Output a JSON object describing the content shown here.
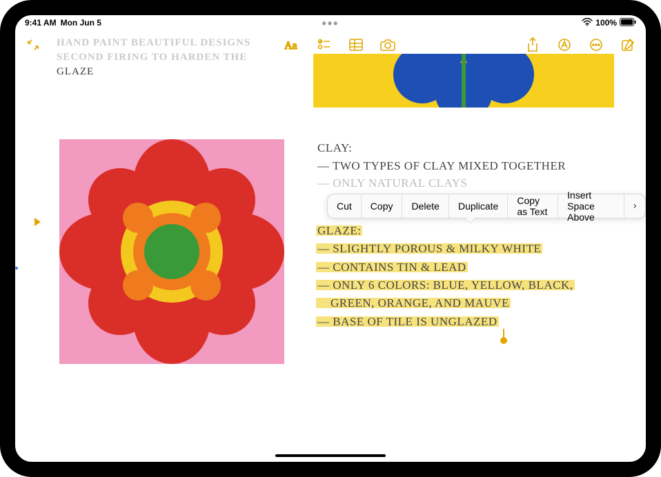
{
  "status": {
    "time": "9:41 AM",
    "date": "Mon Jun 5",
    "battery_pct": "100%"
  },
  "left_note": {
    "line1": "HAND PAINT BEAUTIFUL DESIGNS",
    "line2": "SECOND FIRING TO HARDEN THE",
    "line3": "GLAZE"
  },
  "clay": {
    "title": "CLAY:",
    "items": [
      "TWO TYPES OF CLAY MIXED TOGETHER",
      "ONLY NATURAL CLAYS"
    ]
  },
  "glaze": {
    "title": "GLAZE:",
    "items": [
      "SLIGHTLY POROUS & MILKY WHITE",
      "CONTAINS TIN & LEAD",
      "ONLY 6 COLORS: BLUE, YELLOW, BLACK,",
      "GREEN, ORANGE, AND MAUVE",
      "BASE OF TILE IS UNGLAZED"
    ]
  },
  "context_menu": {
    "cut": "Cut",
    "copy": "Copy",
    "delete": "Delete",
    "duplicate": "Duplicate",
    "copy_as_text": "Copy as Text",
    "insert_space": "Insert Space Above"
  },
  "colors": {
    "accent": "#e0a800",
    "tile_bg": "#f29abf",
    "flower_red": "#d92f28",
    "flower_orange": "#f07b1f",
    "flower_green": "#3a9a3a",
    "flower_yellow": "#f3c81f",
    "top_blue": "#1e4fb5",
    "top_green": "#3a9a3a",
    "top_bg": "#f7cf1e"
  }
}
